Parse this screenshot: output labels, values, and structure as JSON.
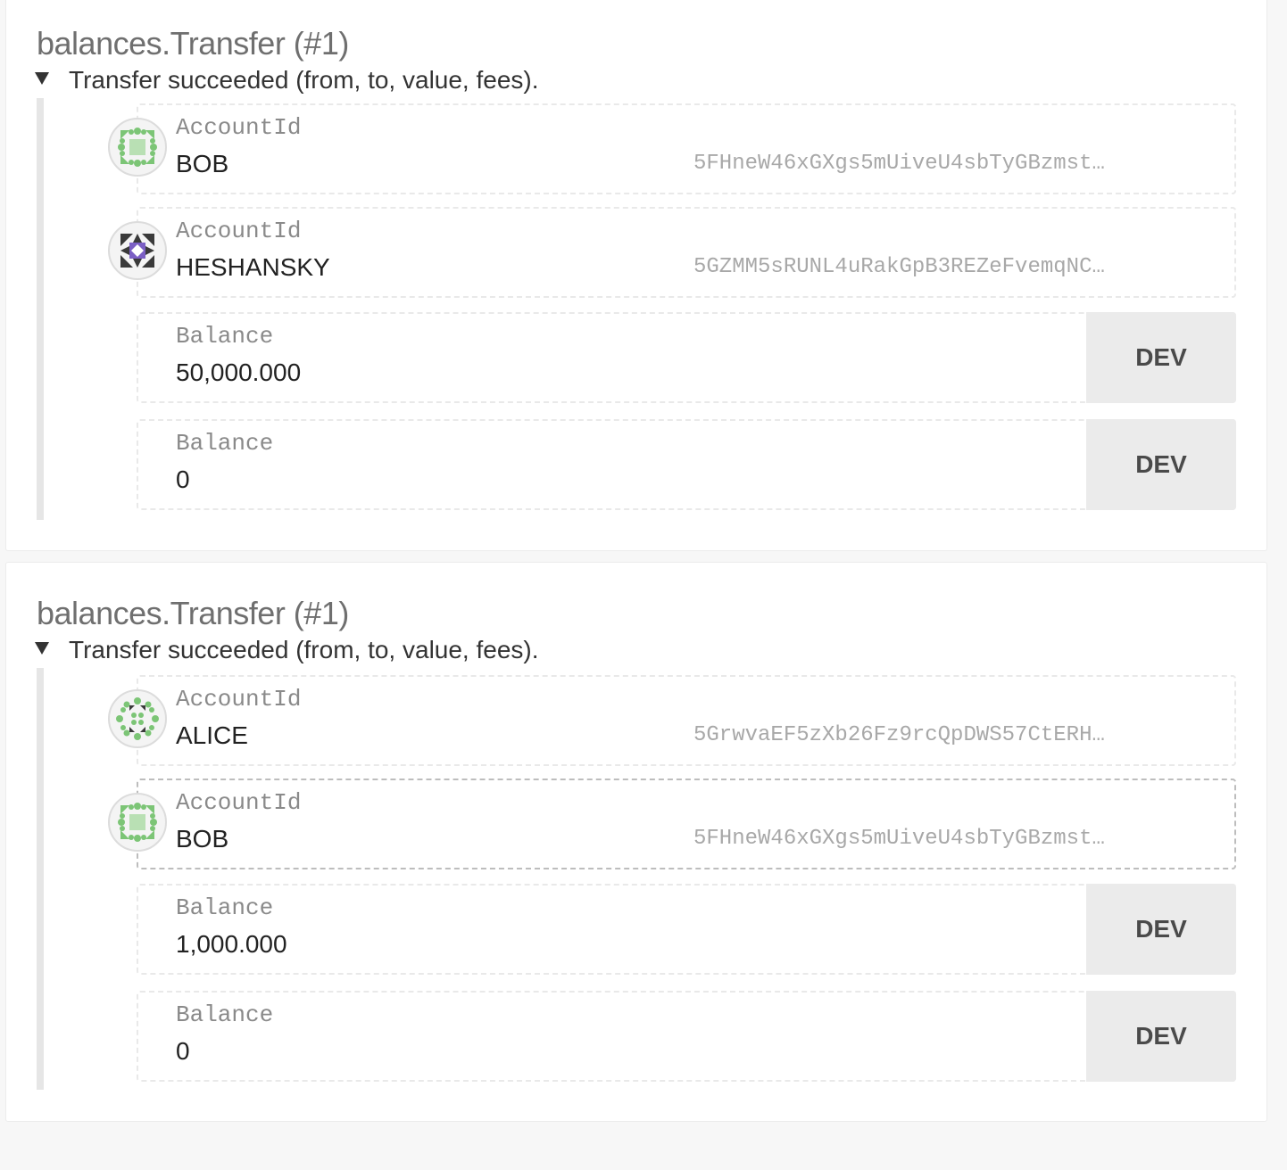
{
  "events": [
    {
      "title": "balances.Transfer (#1)",
      "summary": "Transfer succeeded (from, to, value, fees).",
      "params": [
        {
          "type": "AccountId",
          "name": "BOB",
          "address": "5FHneW46xGXgs5mUiveU4sbTyGBzmst…",
          "icon": "identicon-green"
        },
        {
          "type": "AccountId",
          "name": "HESHANSKY",
          "address": "5GZMM5sRUNL4uRakGpB3REZeFvemqNC…",
          "icon": "identicon-purple"
        },
        {
          "type": "Balance",
          "value": "50,000.000",
          "unit": "DEV"
        },
        {
          "type": "Balance",
          "value": "0",
          "unit": "DEV"
        }
      ]
    },
    {
      "title": "balances.Transfer (#1)",
      "summary": "Transfer succeeded (from, to, value, fees).",
      "params": [
        {
          "type": "AccountId",
          "name": "ALICE",
          "address": "5GrwvaEF5zXb26Fz9rcQpDWS57CtERH…",
          "icon": "identicon-dots"
        },
        {
          "type": "AccountId",
          "name": "BOB",
          "address": "5FHneW46xGXgs5mUiveU4sbTyGBzmst…",
          "icon": "identicon-green"
        },
        {
          "type": "Balance",
          "value": "1,000.000",
          "unit": "DEV"
        },
        {
          "type": "Balance",
          "value": "0",
          "unit": "DEV"
        }
      ]
    }
  ],
  "colors": {
    "identicon_green": "#7cc576",
    "identicon_purple": "#7b5fc4",
    "identicon_dark": "#3a3a3a"
  }
}
